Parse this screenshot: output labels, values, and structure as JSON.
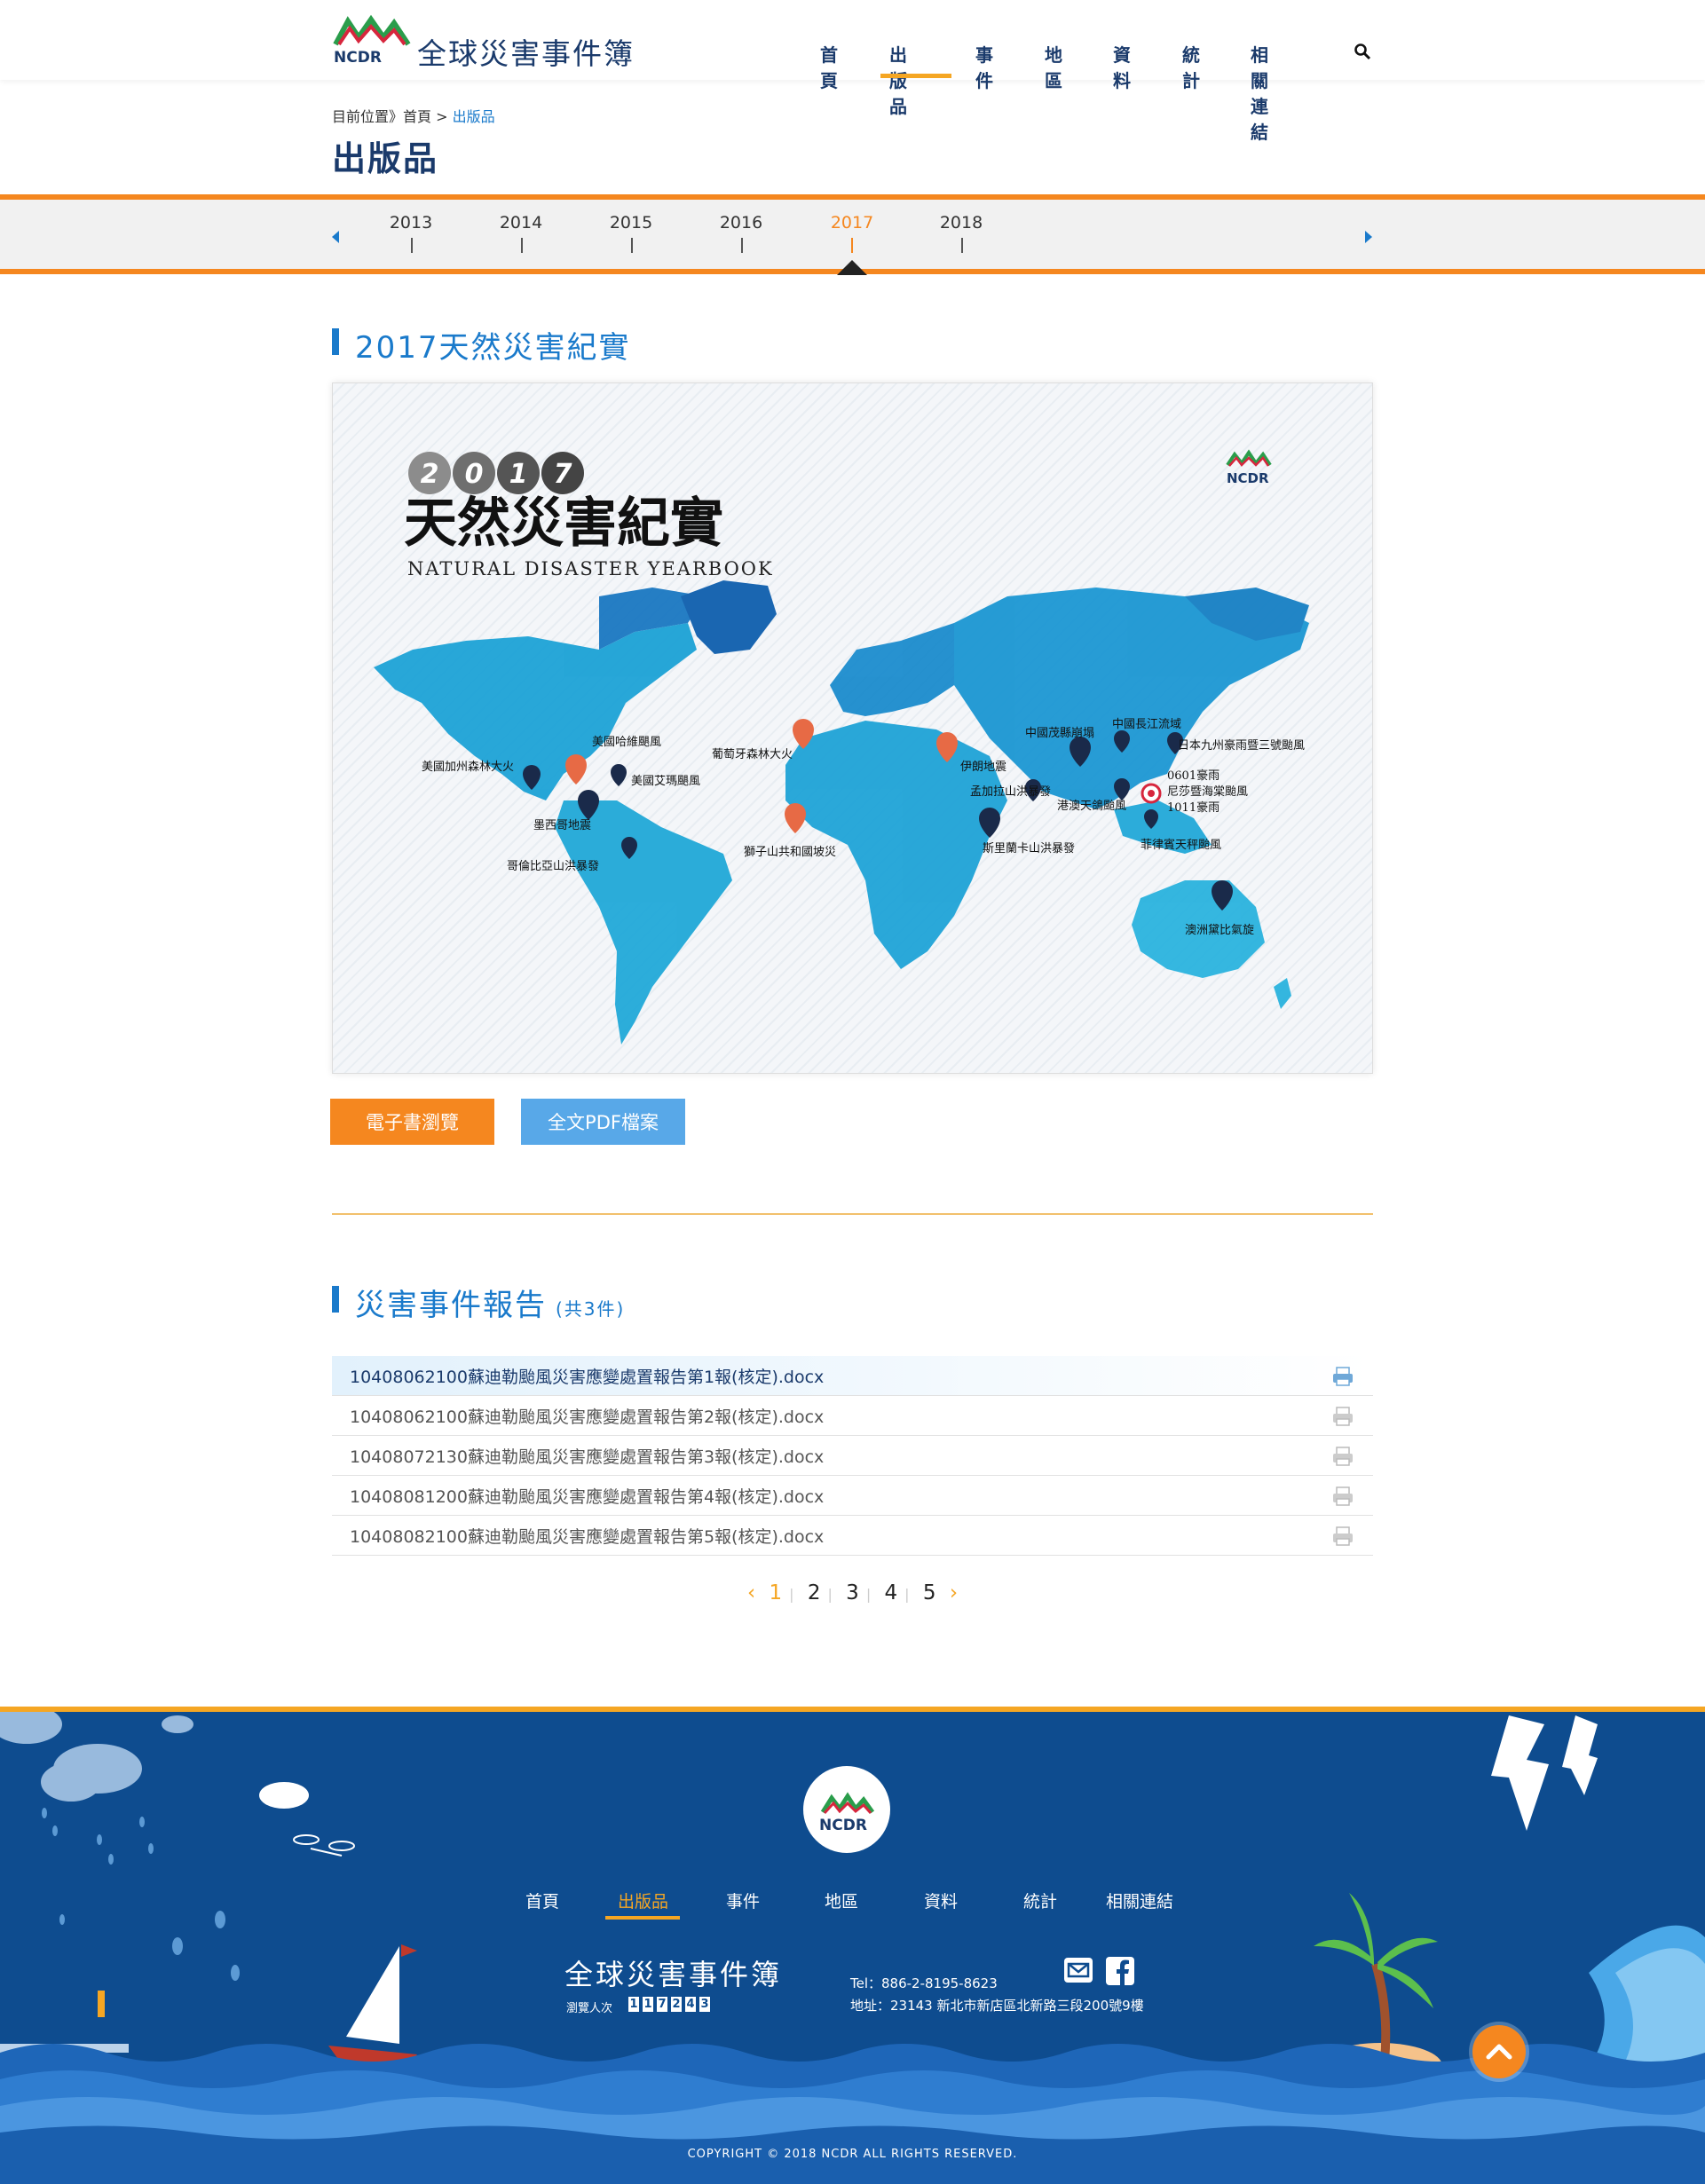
{
  "header": {
    "site_title": "全球災害事件簿",
    "logo_text": "NCDR",
    "nav": [
      "首頁",
      "出版品",
      "事件",
      "地區",
      "資料",
      "統計",
      "相關連結"
    ],
    "active_nav": "出版品"
  },
  "breadcrumb": {
    "prefix": "目前位置》首頁 >",
    "current": "出版品"
  },
  "page_title": "出版品",
  "timeline": {
    "years": [
      "2013",
      "2014",
      "2015",
      "2016",
      "2017",
      "2018"
    ],
    "active": "2017"
  },
  "publication": {
    "heading": "2017天然災害紀實",
    "cover": {
      "year_badges": [
        "2",
        "0",
        "1",
        "7"
      ],
      "title": "天然災害紀實",
      "subtitle": "NATURAL DISASTER YEARBOOK",
      "logo_text": "NCDR",
      "map_labels": [
        "美國加州森林大火",
        "美國哈維颶風",
        "美國艾瑪颶風",
        "墨西哥地震",
        "哥倫比亞山洪暴發",
        "葡萄牙森林大火",
        "獅子山共和國坡災",
        "伊朗地震",
        "孟加拉山洪暴發",
        "斯里蘭卡山洪暴發",
        "中國茂縣崩塌",
        "中國長江流域",
        "日本九州豪雨暨三號颱風",
        "港澳天鴿颱風",
        "0601豪雨",
        "尼莎暨海棠颱風",
        "1011豪雨",
        "菲律賓天秤颱風",
        "澳洲黛比氣旋"
      ]
    },
    "buttons": {
      "ebook": "電子書瀏覽",
      "pdf": "全文PDF檔案"
    }
  },
  "reports": {
    "heading": "災害事件報告",
    "count_label": "(共3件)",
    "items": [
      "10408062100蘇迪勒颱風災害應變處置報告第1報(核定).docx",
      "10408062100蘇迪勒颱風災害應變處置報告第2報(核定).docx",
      "10408072130蘇迪勒颱風災害應變處置報告第3報(核定).docx",
      "10408081200蘇迪勒颱風災害應變處置報告第4報(核定).docx",
      "10408082100蘇迪勒颱風災害應變處置報告第5報(核定).docx"
    ],
    "pagination": {
      "prev": "‹",
      "pages": [
        "1",
        "2",
        "3",
        "4",
        "5"
      ],
      "current": "1",
      "next": "›"
    }
  },
  "footer": {
    "logo_text": "NCDR",
    "nav": [
      "首頁",
      "出版品",
      "事件",
      "地區",
      "資料",
      "統計",
      "相關連結"
    ],
    "active_nav": "出版品",
    "title": "全球災害事件簿",
    "visitors_label": "瀏覽人次",
    "visitor_digits": [
      "1",
      "1",
      "7",
      "2",
      "4",
      "3"
    ],
    "tel": "Tel：886-2-8195-8623",
    "address": "地址：23143 新北市新店區北新路三段200號9樓",
    "copyright": "COPYRIGHT © 2018 NCDR ALL RIGHTS RESERVED."
  },
  "colors": {
    "brand_blue": "#1a3a6b",
    "accent_orange": "#f5871f",
    "link_blue": "#1a7acb",
    "footer_bg": "#0e4c8f"
  }
}
